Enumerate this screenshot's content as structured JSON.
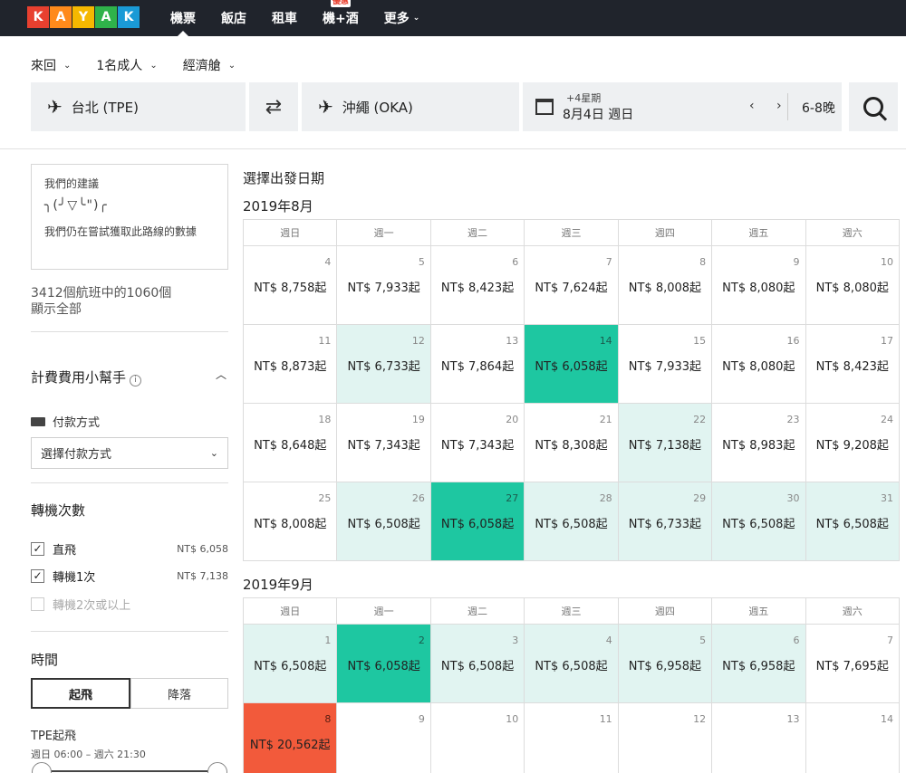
{
  "logo": {
    "letters": [
      "K",
      "A",
      "Y",
      "A",
      "K"
    ],
    "colors": [
      "#e8402f",
      "#ff8a1b",
      "#f5b800",
      "#2fb24a",
      "#1a9ad6"
    ]
  },
  "nav": {
    "items": [
      {
        "label": "機票",
        "active": true
      },
      {
        "label": "飯店"
      },
      {
        "label": "租車"
      },
      {
        "label": "機+酒",
        "badge": "優惠"
      },
      {
        "label": "更多",
        "caret": "⌄"
      }
    ]
  },
  "options": {
    "trip_type": "來回",
    "passengers": "1名成人",
    "cabin": "經濟艙"
  },
  "search": {
    "origin": "台北 (TPE)",
    "destination": "沖繩 (OKA)",
    "date_hint": "+4星期",
    "date": "8月4日 週日",
    "date_arrows": "‹ ›",
    "nights": "6-8晚"
  },
  "sidebar": {
    "advice_title": "我們的建議",
    "advice_face": "╮(╯▽╰\")╭",
    "advice_text": "我們仍在嘗試獲取此路線的數據",
    "flight_count": "3412個航班中的1060個",
    "show_all": "顯示全部",
    "fee_title": "計費費用小幫手",
    "pay_label": "付款方式",
    "pay_select": "選擇付款方式",
    "stops_title": "轉機次數",
    "stops": [
      {
        "label": "直飛",
        "price": "NT$ 6,058",
        "checked": true
      },
      {
        "label": "轉機1次",
        "price": "NT$ 7,138",
        "checked": true
      },
      {
        "label": "轉機2次或以上",
        "price": "",
        "checked": false
      }
    ],
    "time_title": "時間",
    "tab_depart": "起飛",
    "tab_land": "降落",
    "tpe_label": "TPE起飛",
    "tpe_range": "週日 06:00 – 週六 21:30"
  },
  "calendar": {
    "heading": "選擇出發日期",
    "weekdays": [
      "週日",
      "週一",
      "週二",
      "週三",
      "週四",
      "週五",
      "週六"
    ],
    "months": [
      {
        "title": "2019年8月",
        "weeks": [
          [
            {
              "d": "4",
              "p": "NT$ 8,758起"
            },
            {
              "d": "5",
              "p": "NT$ 7,933起"
            },
            {
              "d": "6",
              "p": "NT$ 8,423起"
            },
            {
              "d": "7",
              "p": "NT$ 7,624起"
            },
            {
              "d": "8",
              "p": "NT$ 8,008起"
            },
            {
              "d": "9",
              "p": "NT$ 8,080起"
            },
            {
              "d": "10",
              "p": "NT$ 8,080起"
            }
          ],
          [
            {
              "d": "11",
              "p": "NT$ 8,873起"
            },
            {
              "d": "12",
              "p": "NT$ 6,733起",
              "c": "lt"
            },
            {
              "d": "13",
              "p": "NT$ 7,864起"
            },
            {
              "d": "14",
              "p": "NT$ 6,058起",
              "c": "teal"
            },
            {
              "d": "15",
              "p": "NT$ 7,933起"
            },
            {
              "d": "16",
              "p": "NT$ 8,080起"
            },
            {
              "d": "17",
              "p": "NT$ 8,423起"
            }
          ],
          [
            {
              "d": "18",
              "p": "NT$ 8,648起"
            },
            {
              "d": "19",
              "p": "NT$ 7,343起"
            },
            {
              "d": "20",
              "p": "NT$ 7,343起"
            },
            {
              "d": "21",
              "p": "NT$ 8,308起"
            },
            {
              "d": "22",
              "p": "NT$ 7,138起",
              "c": "lt"
            },
            {
              "d": "23",
              "p": "NT$ 8,983起"
            },
            {
              "d": "24",
              "p": "NT$ 9,208起"
            }
          ],
          [
            {
              "d": "25",
              "p": "NT$ 8,008起"
            },
            {
              "d": "26",
              "p": "NT$ 6,508起",
              "c": "lt"
            },
            {
              "d": "27",
              "p": "NT$ 6,058起",
              "c": "teal"
            },
            {
              "d": "28",
              "p": "NT$ 6,508起",
              "c": "lt"
            },
            {
              "d": "29",
              "p": "NT$ 6,733起",
              "c": "lt"
            },
            {
              "d": "30",
              "p": "NT$ 6,508起",
              "c": "lt"
            },
            {
              "d": "31",
              "p": "NT$ 6,508起",
              "c": "lt"
            }
          ]
        ]
      },
      {
        "title": "2019年9月",
        "weeks": [
          [
            {
              "d": "1",
              "p": "NT$ 6,508起",
              "c": "lt"
            },
            {
              "d": "2",
              "p": "NT$ 6,058起",
              "c": "teal"
            },
            {
              "d": "3",
              "p": "NT$ 6,508起",
              "c": "lt"
            },
            {
              "d": "4",
              "p": "NT$ 6,508起",
              "c": "lt"
            },
            {
              "d": "5",
              "p": "NT$ 6,958起",
              "c": "lt"
            },
            {
              "d": "6",
              "p": "NT$ 6,958起",
              "c": "lt"
            },
            {
              "d": "7",
              "p": "NT$ 7,695起"
            }
          ],
          [
            {
              "d": "8",
              "p": "NT$ 20,562起",
              "c": "red"
            },
            {
              "d": "9",
              "p": ""
            },
            {
              "d": "10",
              "p": ""
            },
            {
              "d": "11",
              "p": ""
            },
            {
              "d": "12",
              "p": ""
            },
            {
              "d": "13",
              "p": ""
            },
            {
              "d": "14",
              "p": ""
            }
          ]
        ]
      }
    ]
  },
  "colors": {
    "cheapest": "#1ec7a1",
    "cheap": "#e1f4f1",
    "expensive": "#f25a3b",
    "nav_bg": "#20242c"
  }
}
